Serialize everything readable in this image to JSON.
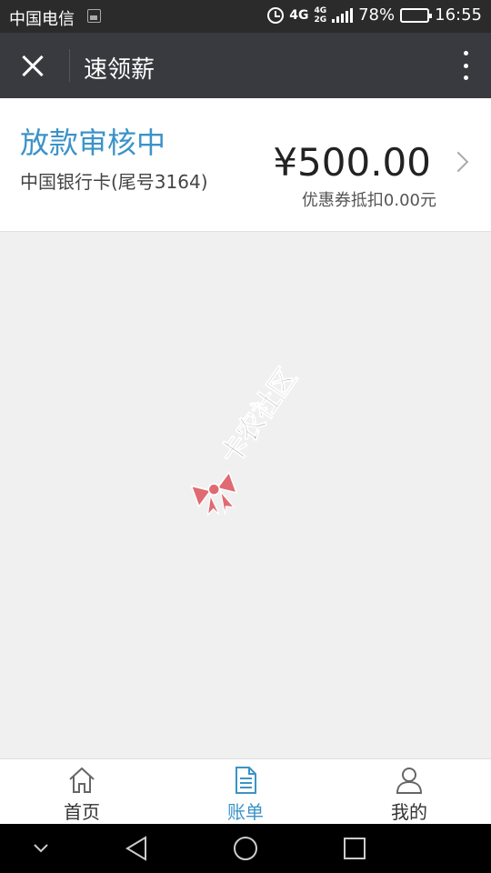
{
  "status_bar": {
    "carrier": "中国电信",
    "network": "4G",
    "network_stack_top": "4G",
    "network_stack_bottom": "2G",
    "battery": "78%",
    "battery_level": 0.78,
    "time": "16:55"
  },
  "nav": {
    "title": "速领薪",
    "close_icon": "close-icon",
    "more_icon": "more-vertical-icon"
  },
  "loan": {
    "status": "放款审核中",
    "bank": "中国银行卡(尾号3164)",
    "amount": "¥500.00",
    "coupon": "优惠券抵扣0.00元"
  },
  "watermark": {
    "text": "卡农社区"
  },
  "tabs": [
    {
      "label": "首页",
      "icon": "home-icon",
      "active": false
    },
    {
      "label": "账单",
      "icon": "bill-icon",
      "active": true
    },
    {
      "label": "我的",
      "icon": "user-icon",
      "active": false
    }
  ],
  "colors": {
    "accent": "#3b93c8",
    "nav_bg": "#393a3f",
    "page_bg": "#f0f0f0"
  }
}
